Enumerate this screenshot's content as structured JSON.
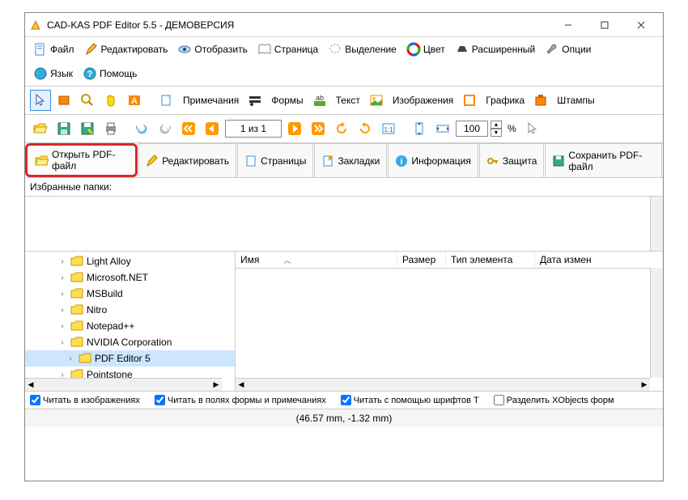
{
  "title": "CAD-KAS PDF Editor 5.5 - ДЕМОВЕРСИЯ",
  "menu": {
    "file": "Файл",
    "edit": "Редактировать",
    "view": "Отобразить",
    "page": "Страница",
    "selection": "Выделение",
    "color": "Цвет",
    "advanced": "Расширенный",
    "options": "Опции",
    "language": "Язык",
    "help": "Помощь"
  },
  "toolbar1": {
    "notes": "Примечания",
    "forms": "Формы",
    "text": "Текст",
    "images": "Изображения",
    "graphics": "Графика",
    "stamps": "Штампы"
  },
  "toolbar2": {
    "page_of": "1 из 1",
    "zoom": "100",
    "percent": "%"
  },
  "tabs": {
    "open": "Открыть PDF-файл",
    "edit": "Редактировать",
    "pages": "Страницы",
    "bookmarks": "Закладки",
    "info": "Информация",
    "security": "Защита",
    "save": "Сохранить PDF-файл"
  },
  "fav_label": "Избранные папки:",
  "tree": [
    {
      "name": "Light Alloy",
      "sel": false
    },
    {
      "name": "Microsoft.NET",
      "sel": false
    },
    {
      "name": "MSBuild",
      "sel": false
    },
    {
      "name": "Nitro",
      "sel": false
    },
    {
      "name": "Notepad++",
      "sel": false
    },
    {
      "name": "NVIDIA Corporation",
      "sel": false
    },
    {
      "name": "PDF Editor 5",
      "sel": true
    },
    {
      "name": "Pointstone",
      "sel": false
    }
  ],
  "list_cols": {
    "name": "Имя",
    "size": "Размер",
    "type": "Тип элемента",
    "date": "Дата измен"
  },
  "checks": {
    "images": "Читать в изображениях",
    "forms": "Читать в полях формы и примечаниях",
    "fonts": "Читать с помощью шрифтов T",
    "xobjects": "Разделить XObjects форм"
  },
  "status": "(46.57 mm, -1.32 mm)"
}
